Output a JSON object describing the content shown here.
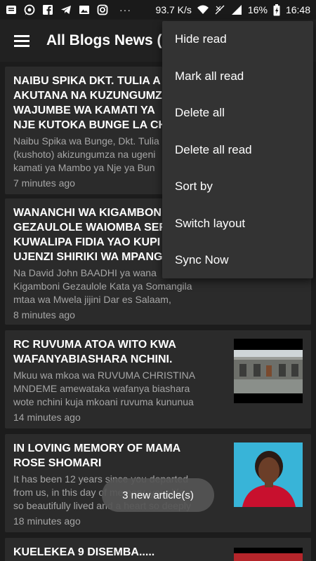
{
  "status_bar": {
    "icons_left": [
      "message-icon",
      "whatsapp-icon",
      "facebook-icon",
      "telegram-icon",
      "gallery-icon",
      "instagram-icon"
    ],
    "more": "···",
    "speed": "93.7 K/s",
    "battery": "16%",
    "time": "16:48"
  },
  "app_bar": {
    "title": "All Blogs News (1"
  },
  "menu": {
    "items": [
      {
        "label": "Hide read"
      },
      {
        "label": "Mark all read"
      },
      {
        "label": "Delete all"
      },
      {
        "label": "Delete all read"
      },
      {
        "label": "Sort by"
      },
      {
        "label": "Switch layout"
      },
      {
        "label": "Sync Now"
      }
    ]
  },
  "articles": [
    {
      "title": "NAIBU SPIKA DKT. TULIA A\nAKUTANA NA KUZUNGUMZ\nWAJUMBE WA KAMATI YA\nNJE KUTOKA BUNGE LA CH",
      "excerpt": "Naibu Spika wa Bunge, Dkt. Tulia\n(kushoto) akizungumza na ugeni\nkamati ya Mambo ya Nje ya Bun",
      "time": "7 minutes ago"
    },
    {
      "title": "WANANCHI WA KIGAMBONI\nGEZAULOLE WAIOMBA SER\nKUWALIPA FIDIA YAO KUPI\nUJENZI SHIRIKI WA MPANG",
      "excerpt": " Na David John BAADHI ya wana\nKigamboni Gezaulole Kata ya Somangila\nmtaa wa Mwela jijini Dar es Salaam,",
      "time": "8 minutes ago"
    },
    {
      "title": "RC RUVUMA ATOA WITO KWA\nWAFANYABIASHARA NCHINI.",
      "excerpt": "Mkuu wa mkoa wa RUVUMA CHRISTINA\nMNDEME amewataka wafanya biashara\nwote nchini kuja mkoani ruvuma kununua",
      "time": "14 minutes ago"
    },
    {
      "title": "IN LOVING MEMORY OF MAMA\nROSE SHOMARI",
      "excerpt": "It has been 12 years since you departed\nfrom us, in this day of memory, your life\nso beautifully lived and a heart so deeply",
      "time": "18 minutes ago"
    },
    {
      "title": "KUELEKEA 9 DISEMBA.....",
      "excerpt": "",
      "time": ""
    }
  ],
  "toast": {
    "text": "3 new article(s)"
  }
}
